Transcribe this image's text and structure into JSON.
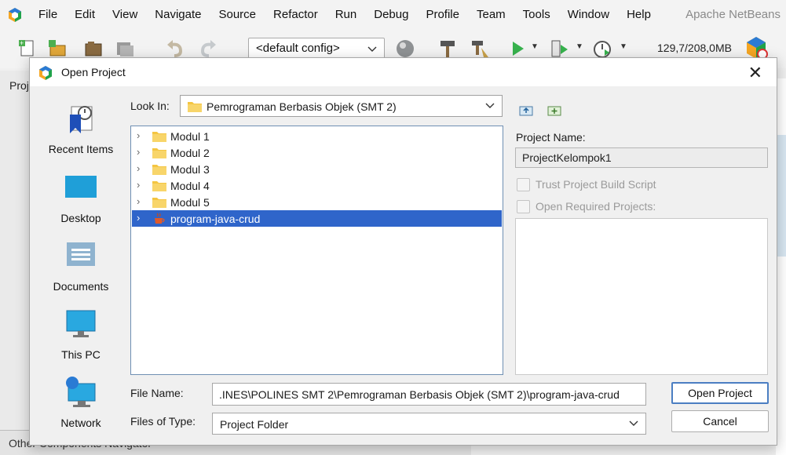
{
  "app": {
    "title": "Apache NetBeans",
    "menu": [
      "File",
      "Edit",
      "View",
      "Navigate",
      "Source",
      "Refactor",
      "Run",
      "Debug",
      "Profile",
      "Team",
      "Tools",
      "Window",
      "Help"
    ],
    "config_select": "<default config>",
    "memory": "129,7/208,0MB",
    "left_panel_tab": "Proj",
    "bottom_tabs": "Other Components   Navigator",
    "icons": [
      "new-file-icon",
      "new-project-icon",
      "open-project-icon",
      "save-all-icon",
      "undo-icon",
      "redo-icon",
      "globe-icon",
      "build-icon",
      "clean-build-icon",
      "run-icon",
      "debug-icon",
      "profile-icon",
      "pause-icon"
    ]
  },
  "dialog": {
    "title": "Open Project",
    "close_symbol": "✕",
    "places": [
      {
        "label": "Recent Items",
        "icon": "recent-items-icon"
      },
      {
        "label": "Desktop",
        "icon": "desktop-icon"
      },
      {
        "label": "Documents",
        "icon": "documents-icon"
      },
      {
        "label": "This PC",
        "icon": "this-pc-icon"
      },
      {
        "label": "Network",
        "icon": "network-icon"
      }
    ],
    "look_in_label": "Look In:",
    "look_in_value": "Pemrograman Berbasis Objek (SMT 2)",
    "files": [
      {
        "name": "Modul 1",
        "type": "folder",
        "selected": false
      },
      {
        "name": "Modul 2",
        "type": "folder",
        "selected": false
      },
      {
        "name": "Modul 3",
        "type": "folder",
        "selected": false
      },
      {
        "name": "Modul 4",
        "type": "folder",
        "selected": false
      },
      {
        "name": "Modul 5",
        "type": "folder",
        "selected": false
      },
      {
        "name": "program-java-crud",
        "type": "project",
        "selected": true
      }
    ],
    "project_name_label": "Project Name:",
    "project_name_value": "ProjectKelompok1",
    "trust_build_script": "Trust Project Build Script",
    "open_required_projects": "Open Required Projects:",
    "file_name_label": "File Name:",
    "file_name_value": ".INES\\POLINES SMT 2\\Pemrograman Berbasis Objek (SMT 2)\\program-java-crud",
    "files_of_type_label": "Files of Type:",
    "files_of_type_value": "Project Folder",
    "open_button": "Open Project",
    "cancel_button": "Cancel"
  },
  "colors": {
    "selection": "#2f65ca",
    "primary_border": "#4b7ec2",
    "folder": "#f4c542"
  }
}
